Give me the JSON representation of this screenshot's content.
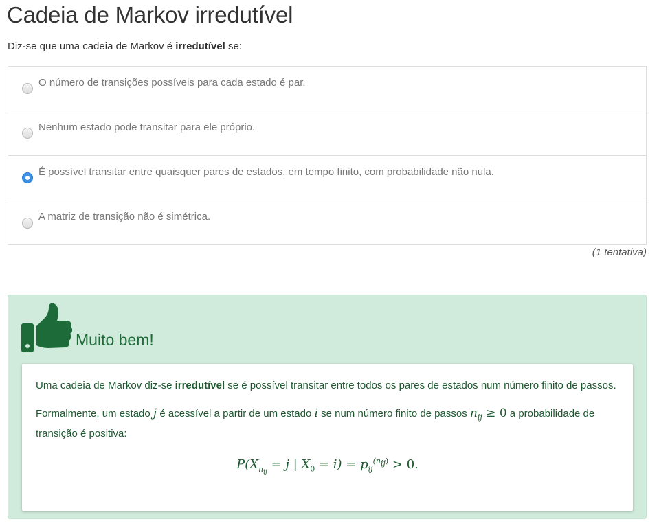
{
  "title": "Cadeia de Markov irredutível",
  "prompt": {
    "before": "Diz-se que uma cadeia de Markov é ",
    "bold": "irredutível",
    "after": " se:"
  },
  "options": [
    {
      "label": "O número de transições possíveis para cada estado é par.",
      "checked": false
    },
    {
      "label": "Nenhum estado pode transitar para ele próprio.",
      "checked": false
    },
    {
      "label": "É possível transitar entre quaisquer pares de estados, em tempo finito, com probabilidade não nula.",
      "checked": true
    },
    {
      "label": "A matriz de transição não é simétrica.",
      "checked": false
    }
  ],
  "attempts": "(1 tentativa)",
  "feedback": {
    "icon": "thumbs-up-icon",
    "title": "Muito bem!",
    "colors": {
      "background": "#d0ebdb",
      "text": "#1e5a30",
      "icon": "#1e6b3a"
    },
    "p1": {
      "before": "Uma cadeia de Markov diz-se ",
      "bold": "irredutível",
      "after": " se é possível transitar entre todos os pares de estados num número finito de passos."
    },
    "p2": {
      "t1": "Formalmente, um estado ",
      "m1": "j",
      "t2": " é acessível a partir de um estado ",
      "m2": "i",
      "t3": " se num número finito de passos ",
      "m3": "n",
      "m3sub": "ij",
      "m3rel": " ≥ 0",
      "t4": " a probabilidade de transição é positiva:"
    },
    "formula": {
      "lhs": "P(X",
      "sub_n": "n",
      "sub_ij": "ij",
      "mid": " = j | X",
      "sub0": "0",
      "mid2": " = i) = p",
      "psub": "ij",
      "psup": "(n",
      "psup_sub": "ij",
      "psup_close": ")",
      "rhs": " > 0."
    }
  }
}
